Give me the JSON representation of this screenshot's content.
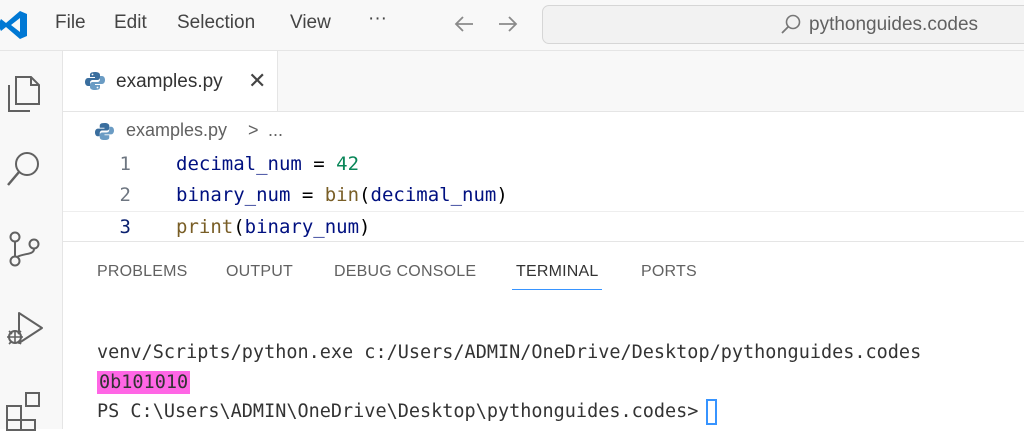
{
  "menu": {
    "file": "File",
    "edit": "Edit",
    "selection": "Selection",
    "view": "View",
    "more": "···"
  },
  "search": {
    "text": "pythonguides.codes"
  },
  "tab": {
    "label": "examples.py",
    "close": "✕"
  },
  "breadcrumb": {
    "file": "examples.py",
    "separator": ">",
    "more": "..."
  },
  "editor": {
    "lines": [
      {
        "number": "1",
        "tokens": [
          "decimal_num",
          " = ",
          "42"
        ]
      },
      {
        "number": "2",
        "tokens": [
          "binary_num",
          " = ",
          "bin",
          "(",
          "decimal_num",
          ")"
        ]
      },
      {
        "number": "3",
        "tokens": [
          "print",
          "(",
          "binary_num",
          ")"
        ]
      }
    ]
  },
  "panel": {
    "tabs": [
      "PROBLEMS",
      "OUTPUT",
      "DEBUG CONSOLE",
      "TERMINAL",
      "PORTS"
    ],
    "active_tab": "TERMINAL"
  },
  "terminal": {
    "command_line": "venv/Scripts/python.exe c:/Users/ADMIN/OneDrive/Desktop/pythonguides.codes",
    "output": "0b101010",
    "prompt": "PS C:\\Users\\ADMIN\\OneDrive\\Desktop\\pythonguides.codes>"
  },
  "colors": {
    "accent": "#3794ff",
    "highlight": "#ff66e5",
    "logo": "#0078d4"
  },
  "icons": [
    "vscode-logo-icon",
    "back-arrow-icon",
    "forward-arrow-icon",
    "search-icon",
    "explorer-icon",
    "search-activity-icon",
    "source-control-icon",
    "run-debug-icon",
    "extensions-icon",
    "python-file-icon",
    "close-icon"
  ]
}
